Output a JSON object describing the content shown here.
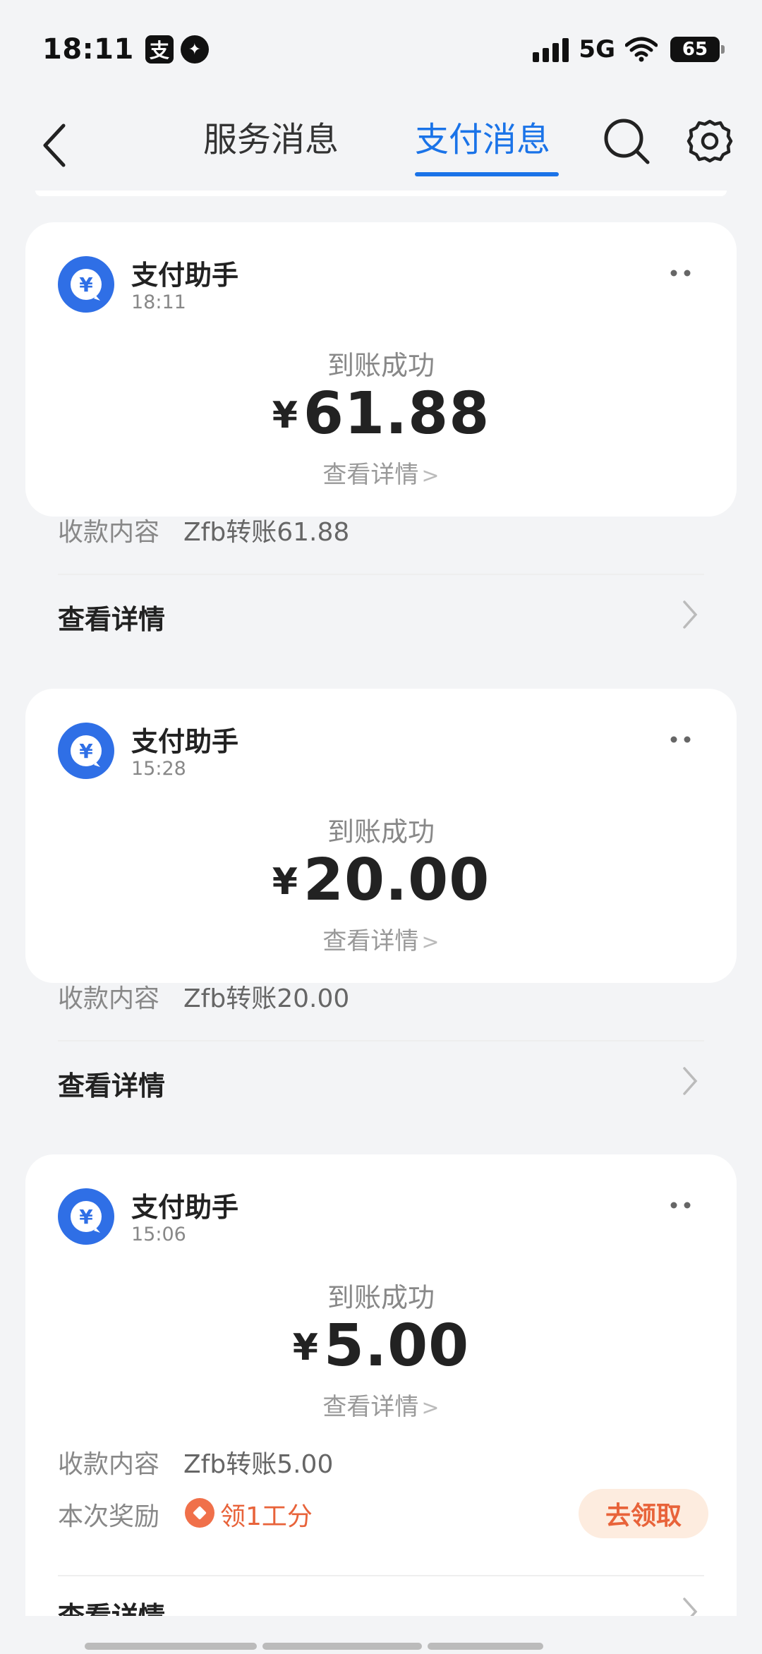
{
  "status_bar": {
    "time": "18:11",
    "app_icon": "支",
    "network": "5G",
    "battery": "65"
  },
  "header": {
    "tabs": [
      {
        "label": "服务消息",
        "active": false
      },
      {
        "label": "支付消息",
        "active": true
      }
    ],
    "accent_color": "#1a73e8"
  },
  "cards": [
    {
      "sender": "支付助手",
      "time": "18:11",
      "status": "到账成功",
      "currency": "¥",
      "amount": "61.88",
      "detail_link": "查看详情",
      "content_label": "收款内容",
      "content_value": "Zfb转账61.88",
      "footer_label": "查看详情"
    },
    {
      "sender": "支付助手",
      "time": "15:28",
      "status": "到账成功",
      "currency": "¥",
      "amount": "20.00",
      "detail_link": "查看详情",
      "content_label": "收款内容",
      "content_value": "Zfb转账20.00",
      "footer_label": "查看详情"
    },
    {
      "sender": "支付助手",
      "time": "15:06",
      "status": "到账成功",
      "currency": "¥",
      "amount": "5.00",
      "detail_link": "查看详情",
      "content_label": "收款内容",
      "content_value": "Zfb转账5.00",
      "reward_label": "本次奖励",
      "reward_text": "领1工分",
      "claim_button": "去领取",
      "footer_label": "查看详情"
    }
  ]
}
